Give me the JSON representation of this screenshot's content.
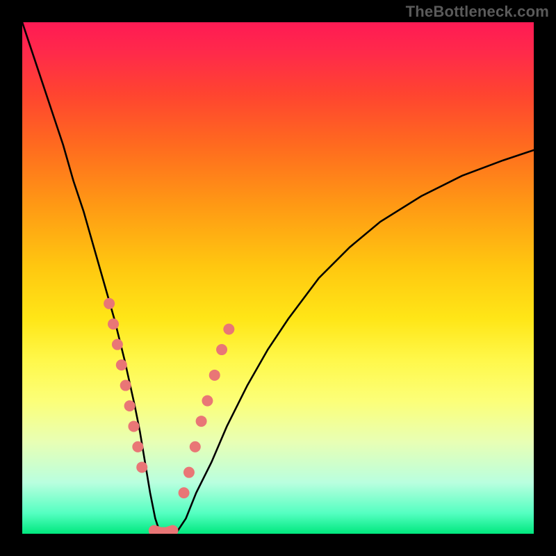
{
  "watermark": "TheBottleneck.com",
  "chart_data": {
    "type": "line",
    "title": "",
    "xlabel": "",
    "ylabel": "",
    "xlim": [
      0,
      100
    ],
    "ylim": [
      0,
      100
    ],
    "grid": false,
    "legend": false,
    "series": [
      {
        "name": "bottleneck-curve",
        "x": [
          0,
          2,
          4,
          6,
          8,
          10,
          12,
          14,
          16,
          18,
          20,
          22,
          23,
          24,
          25,
          26,
          27,
          28,
          30,
          32,
          34,
          37,
          40,
          44,
          48,
          52,
          58,
          64,
          70,
          78,
          86,
          94,
          100
        ],
        "y": [
          100,
          94,
          88,
          82,
          76,
          69,
          63,
          56,
          49,
          42,
          34,
          25,
          20,
          14,
          8,
          3,
          0,
          0,
          0,
          3,
          8,
          14,
          21,
          29,
          36,
          42,
          50,
          56,
          61,
          66,
          70,
          73,
          75
        ]
      }
    ],
    "markers": {
      "name": "highlight-dots",
      "color": "#e97676",
      "left_arm": [
        {
          "x": 17.0,
          "y": 45
        },
        {
          "x": 17.8,
          "y": 41
        },
        {
          "x": 18.6,
          "y": 37
        },
        {
          "x": 19.4,
          "y": 33
        },
        {
          "x": 20.2,
          "y": 29
        },
        {
          "x": 21.0,
          "y": 25
        },
        {
          "x": 21.8,
          "y": 21
        },
        {
          "x": 22.6,
          "y": 17
        },
        {
          "x": 23.4,
          "y": 13
        }
      ],
      "valley": [
        {
          "x": 25.8,
          "y": 0.6
        },
        {
          "x": 27.0,
          "y": 0.2
        },
        {
          "x": 28.2,
          "y": 0.2
        },
        {
          "x": 29.4,
          "y": 0.6
        }
      ],
      "right_arm": [
        {
          "x": 31.6,
          "y": 8
        },
        {
          "x": 32.6,
          "y": 12
        },
        {
          "x": 33.8,
          "y": 17
        },
        {
          "x": 35.0,
          "y": 22
        },
        {
          "x": 36.2,
          "y": 26
        },
        {
          "x": 37.6,
          "y": 31
        },
        {
          "x": 39.0,
          "y": 36
        },
        {
          "x": 40.4,
          "y": 40
        }
      ]
    }
  }
}
